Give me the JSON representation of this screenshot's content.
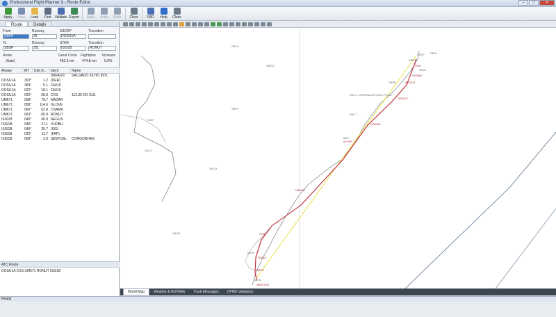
{
  "window": {
    "title": "Professional Flight Planner X - Route Editor"
  },
  "toolbar": {
    "buttons": [
      {
        "label": "Apply",
        "icon": "check-icon",
        "color": "#3f9b3a",
        "enabled": true
      },
      {
        "label": "Save",
        "icon": "save-icon",
        "color": "#7a8fb2",
        "enabled": false
      },
      {
        "label": "Load",
        "icon": "folder-icon",
        "color": "#e4b64a",
        "enabled": true
      },
      {
        "label": "Find",
        "icon": "magnifier-icon",
        "color": "#5b6e84",
        "enabled": true
      },
      {
        "label": "Validate",
        "icon": "validate-icon",
        "color": "#4a6db0",
        "enabled": true
      },
      {
        "label": "Export",
        "icon": "export-icon",
        "color": "#3c8a55",
        "enabled": true
      },
      {
        "label": "Build",
        "icon": "build-icon",
        "color": "#8fa0b5",
        "enabled": false
      },
      {
        "label": "Undo",
        "icon": "undo-icon",
        "color": "#8fa0b5",
        "enabled": false
      },
      {
        "label": "Redo",
        "icon": "redo-icon",
        "color": "#8fa0b5",
        "enabled": false
      },
      {
        "label": "Clear",
        "icon": "clear-icon",
        "color": "#6c7a8c",
        "enabled": true
      },
      {
        "label": "RAD",
        "icon": "rad-icon",
        "color": "#4c6fb8",
        "enabled": true
      },
      {
        "label": "Help",
        "icon": "help-icon",
        "color": "#2f6fc7",
        "enabled": true
      },
      {
        "label": "Close",
        "icon": "close-icon",
        "color": "#6c7a8c",
        "enabled": true
      }
    ]
  },
  "left_tabs": [
    "Route",
    "Details"
  ],
  "form": {
    "from_label": "From",
    "from_value": "SBFA",
    "runway_label": "Runway",
    "from_runway": "29",
    "sid_label": "SID/DP",
    "sid_value": "DOSU1A",
    "transition_label": "Transition",
    "from_transition": "",
    "to_label": "To",
    "to_value": "SBSP",
    "to_runway": "35L",
    "star_label": "STAR",
    "star_value": "ISIS1B",
    "to_transition": "RONUT",
    "route_label": "Route",
    "route_value": "(Auto)",
    "gc_label": "Great Circle",
    "gc_value": "452.3 nm",
    "fp_label": "Flightplan",
    "fp_value": "474.8 nm",
    "inc_label": "Increase",
    "inc_value": "5.0%"
  },
  "grid": {
    "headers": [
      "Airway",
      "MT",
      "Dist (n...",
      "Ident",
      "Name"
    ],
    "rows": [
      [
        "",
        "",
        "",
        "SBFA/29",
        "SALGADO FILHO INTL"
      ],
      [
        "DOSU1A",
        "303°",
        "1.2",
        "(DER)",
        ""
      ],
      [
        "DOSU1A",
        "284°",
        "5.1",
        "FA019",
        ""
      ],
      [
        "DOSU1A",
        "022°",
        "18.1",
        "FA019",
        ""
      ],
      [
        "DOSU1A",
        "022°",
        "28.9",
        "CXS",
        "112.30  DO SUL"
      ],
      [
        "UM671",
        "058°",
        "79.7",
        "NADAR",
        ""
      ],
      [
        "UM671",
        "058°",
        "114.6",
        "GLOVE",
        ""
      ],
      [
        "UM671",
        "060°",
        "63.8",
        "OSAMU",
        ""
      ],
      [
        "UM671",
        "063°",
        "60.9",
        "RONUT",
        ""
      ],
      [
        "ISIS1B",
        "040°",
        "45.0",
        "NEGUS",
        ""
      ],
      [
        "ISIS1B",
        "046°",
        "21.1",
        "VUDBU",
        ""
      ],
      [
        "ISIS1B",
        "040°",
        "20.7",
        "ISISI",
        ""
      ],
      [
        "ISIS1B",
        "022°",
        "11.7",
        "(FAP)",
        ""
      ],
      [
        "ISIS1B",
        "009°",
        "3.0",
        "SBSP/35L",
        "CONGONHAS"
      ]
    ]
  },
  "atc": {
    "header": "ATC Route",
    "text": "DOSU1A CXS UM671 RONUT ISIS1B"
  },
  "map_tabs": [
    "World Map",
    "Weather & NOTAMs",
    "Track Messages",
    "CPMU Validation"
  ],
  "map_labels": [
    "SBSP",
    "SBSJ",
    "SBKP",
    "SBJD",
    "SBCT",
    "SBCV CURITIBA AFONSO PENA",
    "SBFI",
    "SBPB",
    "SBCH",
    "SBFA",
    "SBPA",
    "SBNF",
    "SBJV",
    "SBLO",
    "SBMG",
    "SBSM",
    "SBPF",
    "SBCX",
    "NADAR",
    "GLOVE",
    "OSAMU",
    "RONUT",
    "NEGUS",
    "VUDBU",
    "ISISI",
    "CXS",
    "FA019",
    "SBFA 029"
  ],
  "status": "Ready"
}
